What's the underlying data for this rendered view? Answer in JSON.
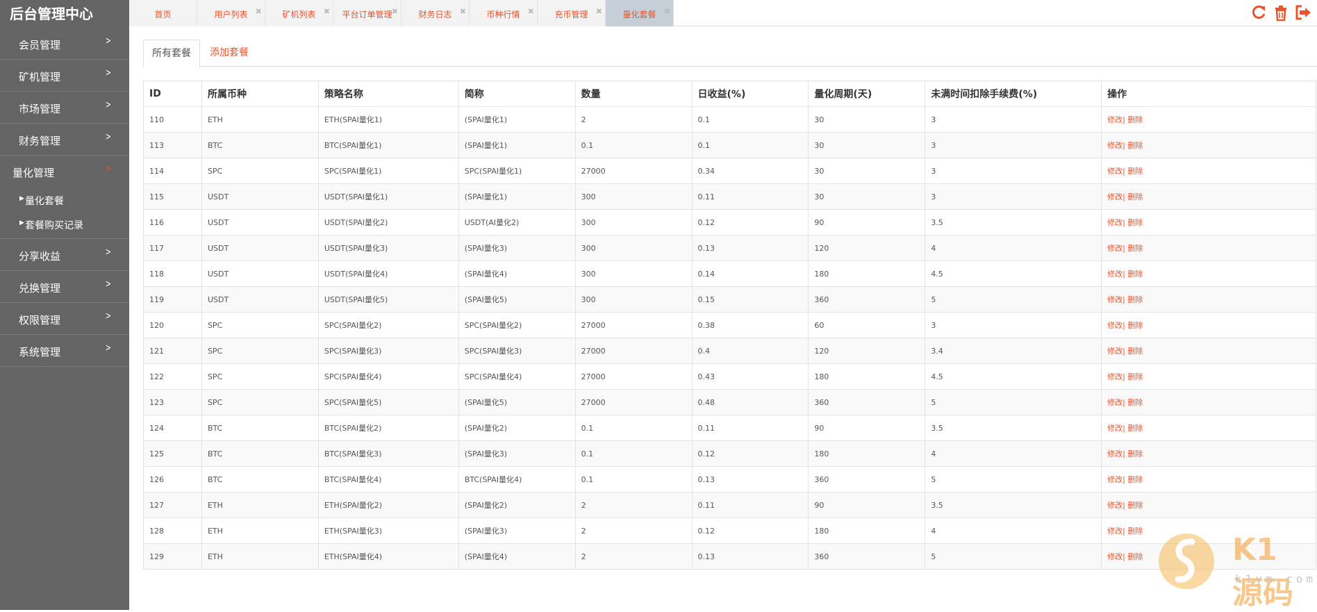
{
  "brand": "后台管理中心",
  "sidebar": {
    "items": [
      {
        "label": "会员管理"
      },
      {
        "label": "矿机管理"
      },
      {
        "label": "市场管理"
      },
      {
        "label": "财务管理"
      },
      {
        "label": "量化管理",
        "open": true,
        "children": [
          {
            "label": "量化套餐"
          },
          {
            "label": "套餐购买记录"
          }
        ]
      },
      {
        "label": "分享收益"
      },
      {
        "label": "兑换管理"
      },
      {
        "label": "权限管理"
      },
      {
        "label": "系统管理"
      }
    ]
  },
  "tabs": [
    {
      "label": "首页"
    },
    {
      "label": "用户列表"
    },
    {
      "label": "矿机列表"
    },
    {
      "label": "平台订单管理"
    },
    {
      "label": "财务日志"
    },
    {
      "label": "币种行情"
    },
    {
      "label": "充币管理"
    },
    {
      "label": "量化套餐",
      "active": true
    }
  ],
  "toolbar": {
    "icons": [
      "refresh-icon",
      "trash-icon",
      "logout-icon"
    ],
    "accent": "#e8542c"
  },
  "subtabs": {
    "all": "所有套餐",
    "add": "添加套餐"
  },
  "table": {
    "headers": [
      "ID",
      "所属币种",
      "策略名称",
      "简称",
      "数量",
      "日收益(%)",
      "量化周期(天)",
      "未满时间扣除手续费(%)",
      "操作"
    ],
    "action_edit": "修改",
    "action_sep": "|",
    "action_delete": "删除",
    "rows": [
      [
        "110",
        "ETH",
        "ETH(SPAI量化1)",
        "(SPAI量化1)",
        "2",
        "0.1",
        "30",
        "3"
      ],
      [
        "113",
        "BTC",
        "BTC(SPAI量化1)",
        "(SPAI量化1)",
        "0.1",
        "0.1",
        "30",
        "3"
      ],
      [
        "114",
        "SPC",
        "SPC(SPAI量化1)",
        "SPC(SPAI量化1)",
        "27000",
        "0.34",
        "30",
        "3"
      ],
      [
        "115",
        "USDT",
        "USDT(SPAI量化1)",
        "(SPAI量化1)",
        "300",
        "0.11",
        "30",
        "3"
      ],
      [
        "116",
        "USDT",
        "USDT(SPAI量化2)",
        "USDT(AI量化2)",
        "300",
        "0.12",
        "90",
        "3.5"
      ],
      [
        "117",
        "USDT",
        "USDT(SPAI量化3)",
        "(SPAI量化3)",
        "300",
        "0.13",
        "120",
        "4"
      ],
      [
        "118",
        "USDT",
        "USDT(SPAI量化4)",
        "(SPAI量化4)",
        "300",
        "0.14",
        "180",
        "4.5"
      ],
      [
        "119",
        "USDT",
        "USDT(SPAI量化5)",
        "(SPAI量化5)",
        "300",
        "0.15",
        "360",
        "5"
      ],
      [
        "120",
        "SPC",
        "SPC(SPAI量化2)",
        "SPC(SPAI量化2)",
        "27000",
        "0.38",
        "60",
        "3"
      ],
      [
        "121",
        "SPC",
        "SPC(SPAI量化3)",
        "SPC(SPAI量化3)",
        "27000",
        "0.4",
        "120",
        "3.4"
      ],
      [
        "122",
        "SPC",
        "SPC(SPAI量化4)",
        "SPC(SPAI量化4)",
        "27000",
        "0.43",
        "180",
        "4.5"
      ],
      [
        "123",
        "SPC",
        "SPC(SPAI量化5)",
        "(SPAI量化5)",
        "27000",
        "0.48",
        "360",
        "5"
      ],
      [
        "124",
        "BTC",
        "BTC(SPAI量化2)",
        "(SPAI量化2)",
        "0.1",
        "0.11",
        "90",
        "3.5"
      ],
      [
        "125",
        "BTC",
        "BTC(SPAI量化3)",
        "(SPAI量化3)",
        "0.1",
        "0.12",
        "180",
        "4"
      ],
      [
        "126",
        "BTC",
        "BTC(SPAI量化4)",
        "BTC(SPAI量化4)",
        "0.1",
        "0.13",
        "360",
        "5"
      ],
      [
        "127",
        "ETH",
        "ETH(SPAI量化2)",
        "(SPAI量化2)",
        "2",
        "0.11",
        "90",
        "3.5"
      ],
      [
        "128",
        "ETH",
        "ETH(SPAI量化3)",
        "(SPAI量化3)",
        "2",
        "0.12",
        "180",
        "4"
      ],
      [
        "129",
        "ETH",
        "ETH(SPAI量化4)",
        "(SPAI量化4)",
        "2",
        "0.13",
        "360",
        "5"
      ]
    ]
  },
  "watermark": {
    "name": "K1源码",
    "site": "k1ym.com"
  }
}
